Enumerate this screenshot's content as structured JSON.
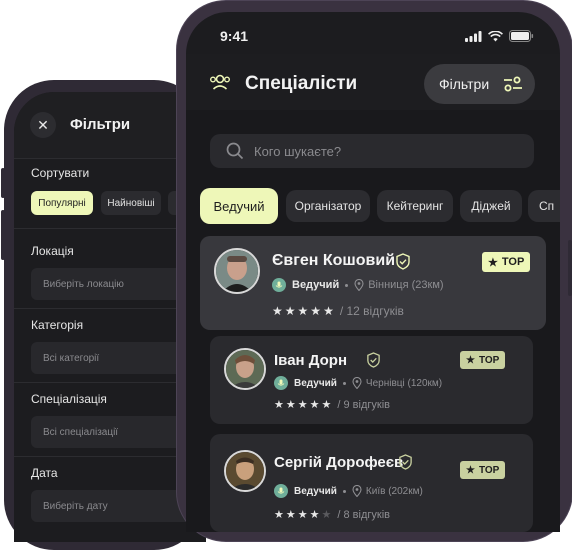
{
  "filters_screen": {
    "title": "Фільтри",
    "sort_label": "Сортувати",
    "sort_options": [
      "Популярні",
      "Найновіші"
    ],
    "location_label": "Локація",
    "location_placeholder": "Виберіть локацію",
    "category_label": "Категорія",
    "category_placeholder": "Всі категорії",
    "specialization_label": "Спеціалізація",
    "specialization_placeholder": "Всі спеціалізації",
    "date_label": "Дата",
    "date_placeholder": "Виберіть дату"
  },
  "status_bar": {
    "time": "9:41"
  },
  "header": {
    "title": "Спеціалісти",
    "filter_button": "Фільтри"
  },
  "search": {
    "placeholder": "Кого шукаєте?"
  },
  "categories": [
    "Ведучий",
    "Організатор",
    "Кейтеринг",
    "Діджей",
    "Сп"
  ],
  "specialists": [
    {
      "name": "Євген Кошовий",
      "role": "Ведучий",
      "location": "Вінниця (23км)",
      "rating": 5,
      "reviews": "/ 12 відгуків",
      "badge": "TOP"
    },
    {
      "name": "Іван Дорн",
      "role": "Ведучий",
      "location": "Чернівці (120км)",
      "rating": 5,
      "reviews": "/ 9 відгуків",
      "badge": "TOP"
    },
    {
      "name": "Сергій Дорофеєв",
      "role": "Ведучий",
      "location": "Київ (202км)",
      "rating": 4,
      "reviews": "/ 8 відгуків",
      "badge": "TOP"
    }
  ],
  "colors": {
    "accent": "#eef7b8",
    "background": "#19191c",
    "card_active": "#38383d",
    "card": "#2a2a2e",
    "role_icon": "#6fae9a"
  }
}
